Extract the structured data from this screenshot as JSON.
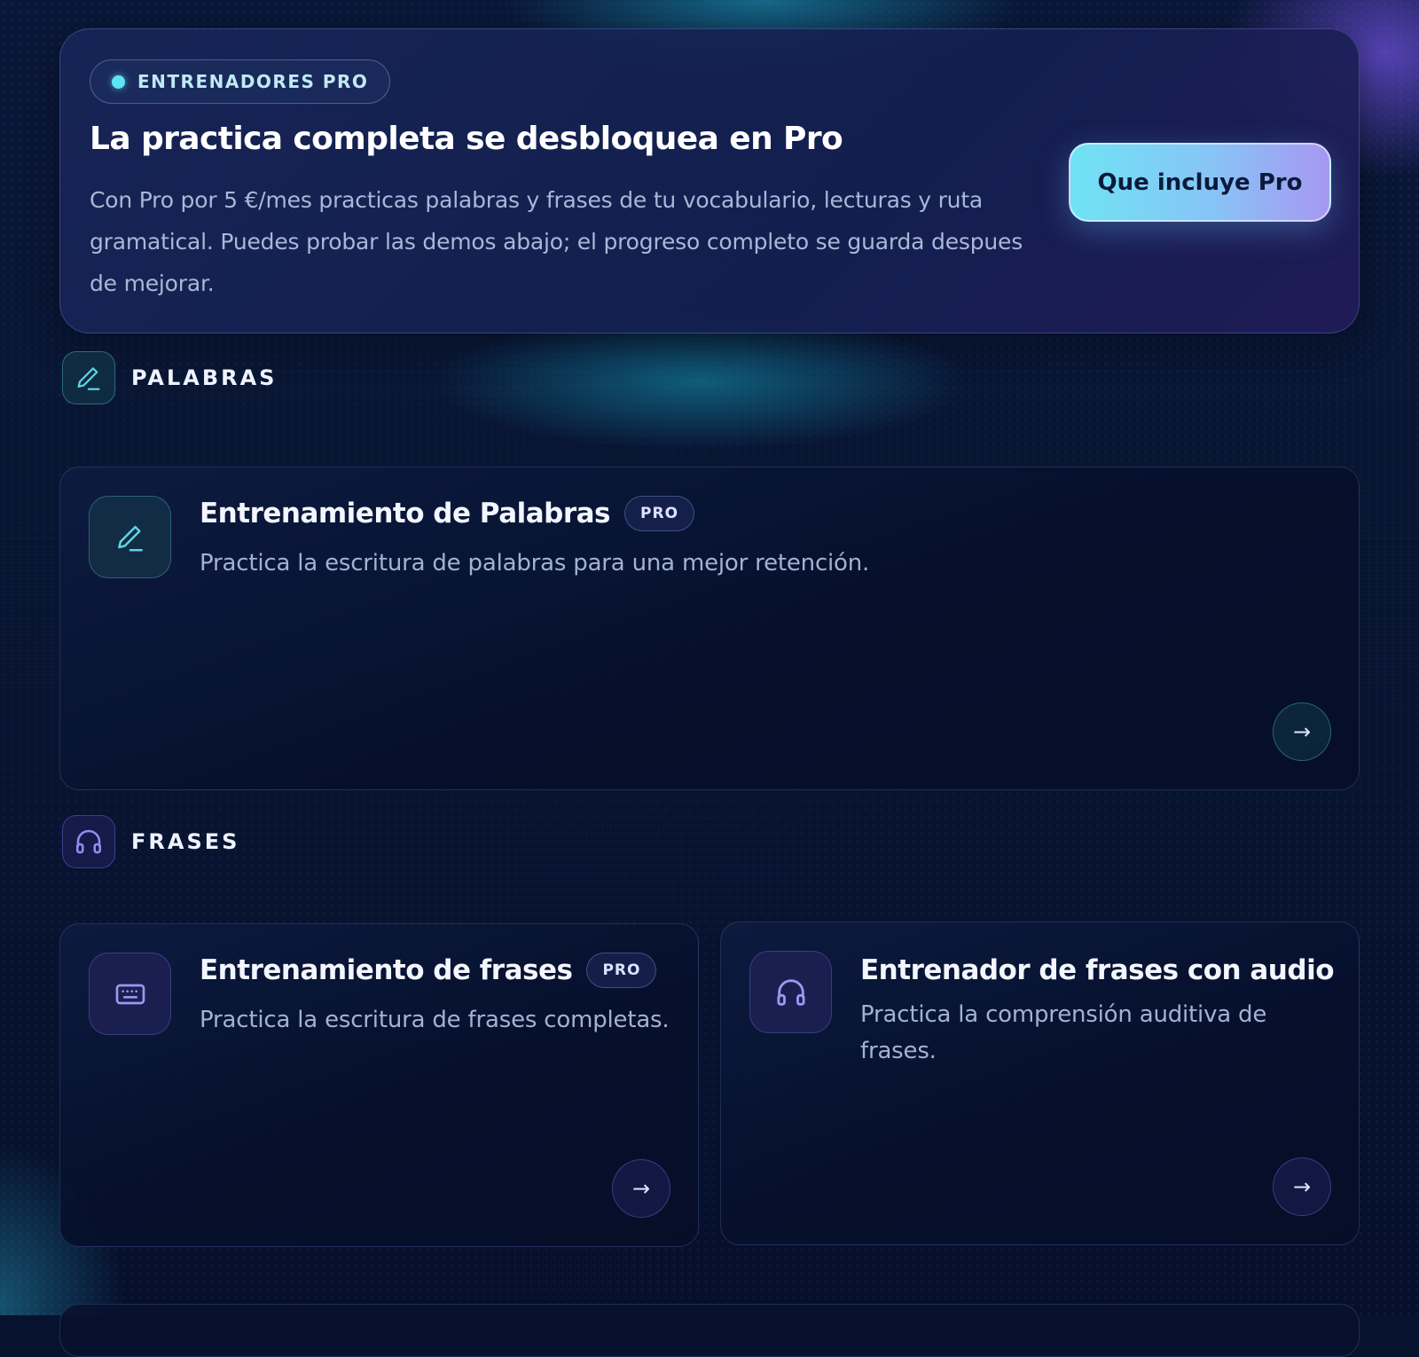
{
  "banner": {
    "pill_label": "ENTRENADORES PRO",
    "title": "La practica completa se desbloquea en Pro",
    "description": "Con Pro por 5 €/mes practicas palabras y frases de tu vocabulario, lecturas y ruta gramatical. Puedes probar las demos abajo; el progreso completo se guarda despues de mejorar.",
    "cta_label": "Que incluye Pro"
  },
  "sections": [
    {
      "label": "PALABRAS",
      "icon": "pencil-icon",
      "cards": [
        {
          "title": "Entrenamiento de Palabras",
          "badge": "PRO",
          "description": "Practica la escritura de palabras para una mejor retención.",
          "icon": "pencil-icon",
          "arrow": "→"
        }
      ]
    },
    {
      "label": "FRASES",
      "icon": "headphones-icon",
      "cards": [
        {
          "title": "Entrenamiento de frases",
          "badge": "PRO",
          "description": "Practica la escritura de frases completas.",
          "icon": "keyboard-icon",
          "arrow": "→"
        },
        {
          "title": "Entrenador de frases con audio",
          "description": "Practica la comprensión auditiva de frases.",
          "icon": "headphones-icon",
          "arrow": "→"
        }
      ]
    }
  ],
  "colors": {
    "accent_cyan": "#5ee5f5",
    "accent_violet": "#a797f1",
    "background": "#07122f"
  }
}
